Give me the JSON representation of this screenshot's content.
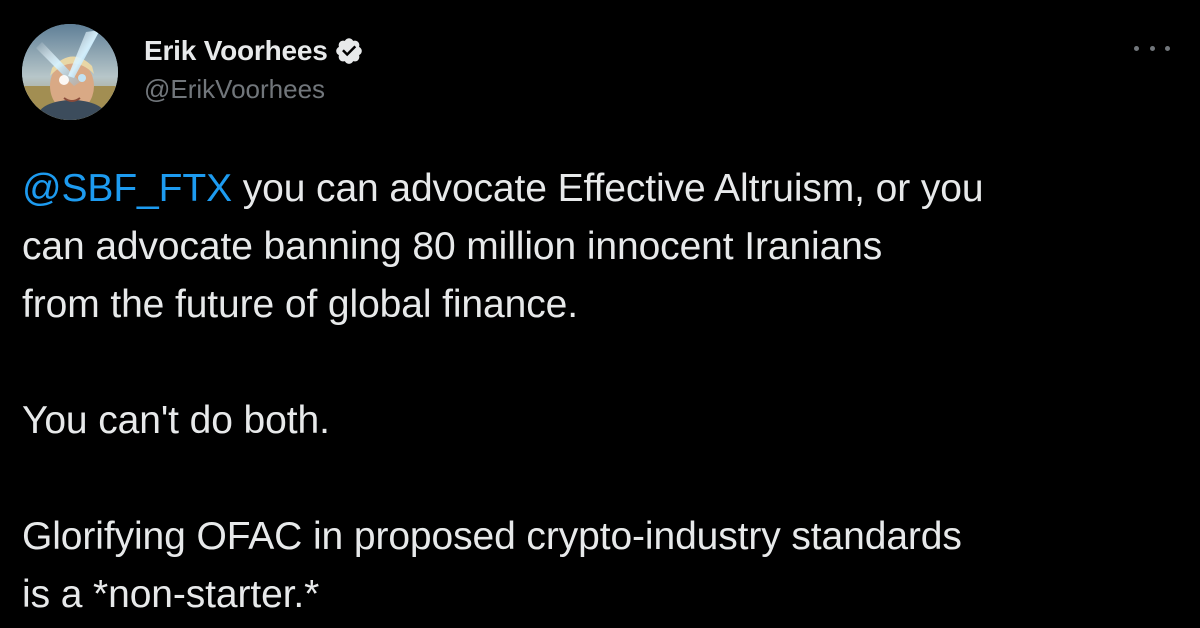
{
  "user": {
    "display_name": "Erik Voorhees",
    "handle": "@ErikVoorhees",
    "verified": true,
    "avatar_icon": "user-avatar"
  },
  "menu": {
    "icon": "more-options-icon"
  },
  "tweet": {
    "mention": "@SBF_FTX",
    "paragraph1_line1_rest": " you can advocate Effective Altruism, or you",
    "paragraph1_line2": "can advocate banning 80 million innocent Iranians",
    "paragraph1_line3": "from the future of global finance.",
    "paragraph2": "You can't do both.",
    "paragraph3_line1": "Glorifying OFAC in proposed crypto-industry standards",
    "paragraph3_line2": "is a *non-starter.*"
  },
  "colors": {
    "background": "#000000",
    "text": "#e7e9ea",
    "secondary": "#71767b",
    "link": "#1d9bf0",
    "verified": "#e7e9ea"
  }
}
